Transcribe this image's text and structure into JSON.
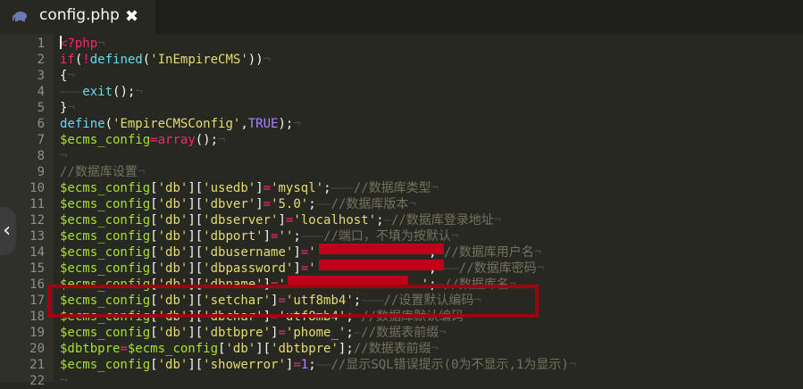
{
  "tab": {
    "title": "config.php",
    "close": "✖",
    "icon": "elephant-php-icon"
  },
  "nav": {
    "arrow": "‹"
  },
  "lines": [
    {
      "n": "1",
      "parts": [
        [
          "k",
          "<?php"
        ],
        [
          "ws",
          "¬"
        ]
      ]
    },
    {
      "n": "2",
      "parts": [
        [
          "k",
          "if"
        ],
        [
          "p",
          "("
        ],
        [
          "k",
          "!"
        ],
        [
          "f",
          "defined"
        ],
        [
          "p",
          "("
        ],
        [
          "s",
          "'InEmpireCMS'"
        ],
        [
          "p",
          "))"
        ],
        [
          "ws",
          "¬"
        ]
      ]
    },
    {
      "n": "3",
      "parts": [
        [
          "p",
          "{"
        ],
        [
          "ws",
          "¬"
        ]
      ]
    },
    {
      "n": "4",
      "parts": [
        [
          "ws",
          "———"
        ],
        [
          "f",
          "exit"
        ],
        [
          "p",
          "();"
        ],
        [
          "ws",
          "¬"
        ]
      ]
    },
    {
      "n": "5",
      "parts": [
        [
          "p",
          "}"
        ],
        [
          "ws",
          "¬"
        ]
      ]
    },
    {
      "n": "6",
      "parts": [
        [
          "f",
          "define"
        ],
        [
          "p",
          "("
        ],
        [
          "s",
          "'EmpireCMSConfig'"
        ],
        [
          "p",
          ","
        ],
        [
          "n",
          "TRUE"
        ],
        [
          "p",
          ");"
        ],
        [
          "ws",
          "¬"
        ]
      ]
    },
    {
      "n": "7",
      "parts": [
        [
          "v",
          "$ecms_config"
        ],
        [
          "k",
          "="
        ],
        [
          "k",
          "array"
        ],
        [
          "p",
          "();"
        ],
        [
          "ws",
          "¬"
        ]
      ]
    },
    {
      "n": "8",
      "parts": [
        [
          "ws",
          "¬"
        ]
      ]
    },
    {
      "n": "9",
      "parts": [
        [
          "c",
          "//数据库设置"
        ],
        [
          "ws",
          "¬"
        ]
      ]
    },
    {
      "n": "10",
      "parts": [
        [
          "v",
          "$ecms_config"
        ],
        [
          "p",
          "["
        ],
        [
          "s",
          "'db'"
        ],
        [
          "p",
          "]["
        ],
        [
          "s",
          "'usedb'"
        ],
        [
          "p",
          "]"
        ],
        [
          "k",
          "="
        ],
        [
          "s",
          "'mysql'"
        ],
        [
          "p",
          ";"
        ],
        [
          "ws",
          "———"
        ],
        [
          "c",
          "//数据库类型"
        ],
        [
          "ws",
          "¬"
        ]
      ]
    },
    {
      "n": "11",
      "parts": [
        [
          "v",
          "$ecms_config"
        ],
        [
          "p",
          "["
        ],
        [
          "s",
          "'db'"
        ],
        [
          "p",
          "]["
        ],
        [
          "s",
          "'dbver'"
        ],
        [
          "p",
          "]"
        ],
        [
          "k",
          "="
        ],
        [
          "s",
          "'5.0'"
        ],
        [
          "p",
          ";"
        ],
        [
          "ws",
          "——"
        ],
        [
          "c",
          "//数据库版本"
        ],
        [
          "ws",
          "¬"
        ]
      ]
    },
    {
      "n": "12",
      "parts": [
        [
          "v",
          "$ecms_config"
        ],
        [
          "p",
          "["
        ],
        [
          "s",
          "'db'"
        ],
        [
          "p",
          "]["
        ],
        [
          "s",
          "'dbserver'"
        ],
        [
          "p",
          "]"
        ],
        [
          "k",
          "="
        ],
        [
          "s",
          "'localhost'"
        ],
        [
          "p",
          ";"
        ],
        [
          "ws",
          "—"
        ],
        [
          "c",
          "//数据库登录地址"
        ],
        [
          "ws",
          "¬"
        ]
      ]
    },
    {
      "n": "13",
      "parts": [
        [
          "v",
          "$ecms_config"
        ],
        [
          "p",
          "["
        ],
        [
          "s",
          "'db'"
        ],
        [
          "p",
          "]["
        ],
        [
          "s",
          "'dbport'"
        ],
        [
          "p",
          "]"
        ],
        [
          "k",
          "="
        ],
        [
          "s",
          "''"
        ],
        [
          "p",
          ";"
        ],
        [
          "ws",
          "———"
        ],
        [
          "c",
          "//端口，不填为按默认"
        ],
        [
          "ws",
          "¬"
        ]
      ]
    },
    {
      "n": "14",
      "parts": [
        [
          "v",
          "$ecms_config"
        ],
        [
          "p",
          "["
        ],
        [
          "s",
          "'db'"
        ],
        [
          "p",
          "]["
        ],
        [
          "s",
          "'dbusername'"
        ],
        [
          "p",
          "]"
        ],
        [
          "k",
          "="
        ],
        [
          "s",
          "'              '"
        ],
        [
          "p",
          ";"
        ],
        [
          "ws",
          "—"
        ],
        [
          "c",
          "//数据库用户名"
        ],
        [
          "ws",
          "¬"
        ]
      ]
    },
    {
      "n": "15",
      "parts": [
        [
          "v",
          "$ecms_config"
        ],
        [
          "p",
          "["
        ],
        [
          "s",
          "'db'"
        ],
        [
          "p",
          "]["
        ],
        [
          "s",
          "'dbpassword'"
        ],
        [
          "p",
          "]"
        ],
        [
          "k",
          "="
        ],
        [
          "s",
          "'              '"
        ],
        [
          "p",
          ";"
        ],
        [
          "ws",
          "———"
        ],
        [
          "c",
          "//数据库密码"
        ],
        [
          "ws",
          "¬"
        ]
      ]
    },
    {
      "n": "16",
      "parts": [
        [
          "v",
          "$ecms_config"
        ],
        [
          "p",
          "["
        ],
        [
          "s",
          "'db'"
        ],
        [
          "p",
          "]["
        ],
        [
          "s",
          "'dbname'"
        ],
        [
          "p",
          "]"
        ],
        [
          "k",
          "="
        ],
        [
          "s",
          "'                  '"
        ],
        [
          "p",
          ";"
        ],
        [
          "ws",
          "—"
        ],
        [
          "c",
          "//数据库名"
        ],
        [
          "ws",
          "¬"
        ]
      ]
    },
    {
      "n": "17",
      "parts": [
        [
          "v",
          "$ecms_config"
        ],
        [
          "p",
          "["
        ],
        [
          "s",
          "'db'"
        ],
        [
          "p",
          "]["
        ],
        [
          "s",
          "'setchar'"
        ],
        [
          "p",
          "]"
        ],
        [
          "k",
          "="
        ],
        [
          "s",
          "'utf8mb4'"
        ],
        [
          "p",
          ";"
        ],
        [
          "ws",
          "———"
        ],
        [
          "c",
          "//设置默认编码"
        ],
        [
          "ws",
          "¬"
        ]
      ]
    },
    {
      "n": "18",
      "parts": [
        [
          "v",
          "$ecms_config"
        ],
        [
          "p",
          "["
        ],
        [
          "s",
          "'db'"
        ],
        [
          "p",
          "]["
        ],
        [
          "s",
          "'dbchar'"
        ],
        [
          "p",
          "]"
        ],
        [
          "k",
          "="
        ],
        [
          "s",
          "'utf8mb4'"
        ],
        [
          "p",
          ";"
        ],
        [
          "ws",
          "—"
        ],
        [
          "c",
          "//数据库默认编码"
        ],
        [
          "ws",
          "¬"
        ]
      ]
    },
    {
      "n": "19",
      "parts": [
        [
          "v",
          "$ecms_config"
        ],
        [
          "p",
          "["
        ],
        [
          "s",
          "'db'"
        ],
        [
          "p",
          "]["
        ],
        [
          "s",
          "'dbtbpre'"
        ],
        [
          "p",
          "]"
        ],
        [
          "k",
          "="
        ],
        [
          "s",
          "'phome_'"
        ],
        [
          "p",
          ";"
        ],
        [
          "ws",
          "—"
        ],
        [
          "c",
          "//数据表前缀"
        ],
        [
          "ws",
          "¬"
        ]
      ]
    },
    {
      "n": "20",
      "parts": [
        [
          "v",
          "$dbtbpre"
        ],
        [
          "k",
          "="
        ],
        [
          "v",
          "$ecms_config"
        ],
        [
          "p",
          "["
        ],
        [
          "s",
          "'db'"
        ],
        [
          "p",
          "]["
        ],
        [
          "s",
          "'dbtbpre'"
        ],
        [
          "p",
          "];"
        ],
        [
          "c",
          "//数据表前缀"
        ],
        [
          "ws",
          "¬"
        ]
      ]
    },
    {
      "n": "21",
      "parts": [
        [
          "v",
          "$ecms_config"
        ],
        [
          "p",
          "["
        ],
        [
          "s",
          "'db'"
        ],
        [
          "p",
          "]["
        ],
        [
          "s",
          "'showerror'"
        ],
        [
          "p",
          "]"
        ],
        [
          "k",
          "="
        ],
        [
          "n",
          "1"
        ],
        [
          "p",
          ";"
        ],
        [
          "ws",
          "——"
        ],
        [
          "c",
          "//显示SQL错误提示(0为不显示,1为显示)"
        ],
        [
          "ws",
          "¬"
        ]
      ]
    },
    {
      "n": "22",
      "parts": [
        [
          "ws",
          "¬"
        ]
      ]
    }
  ]
}
